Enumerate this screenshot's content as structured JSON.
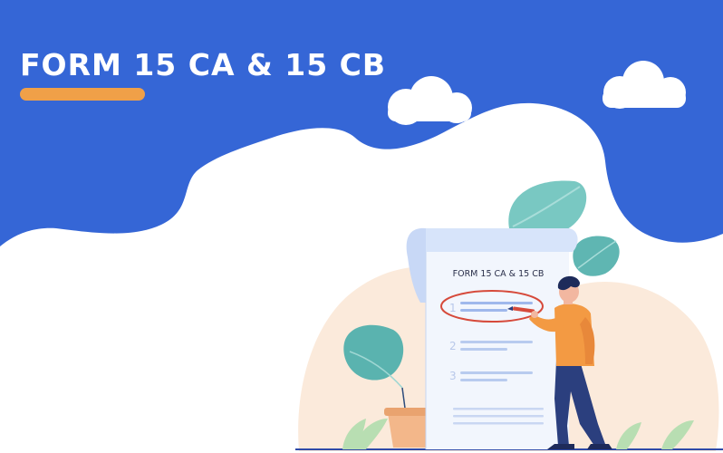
{
  "banner": {
    "title": "FORM 15 CA & 15 CB"
  },
  "illustration": {
    "document_heading": "FORM 15 CA & 15 CB",
    "step_numbers": [
      "1",
      "2",
      "3"
    ]
  },
  "colors": {
    "banner_blue": "#3566d6",
    "accent_orange": "#f0a048",
    "blob_peach": "#fbeadb",
    "leaf_teal": "#6cc2bd",
    "circle_red": "#d64a3b"
  }
}
